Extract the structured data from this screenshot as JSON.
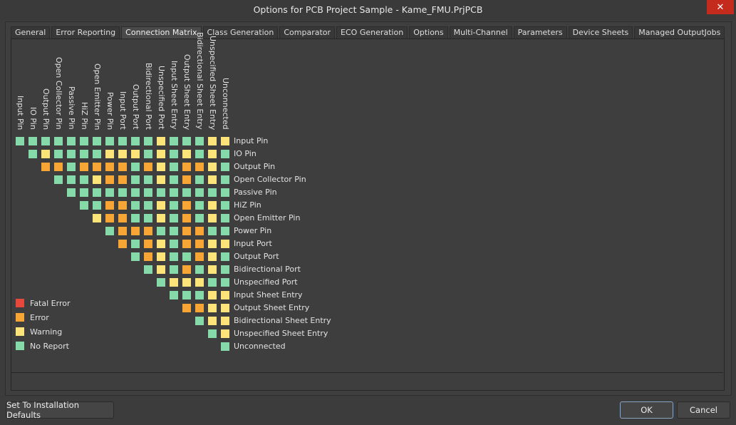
{
  "window": {
    "title": "Options for PCB Project Sample - Kame_FMU.PrjPCB",
    "close_label": "✕"
  },
  "tabs": [
    {
      "label": "General",
      "active": false
    },
    {
      "label": "Error Reporting",
      "active": false
    },
    {
      "label": "Connection Matrix",
      "active": true
    },
    {
      "label": "Class Generation",
      "active": false
    },
    {
      "label": "Comparator",
      "active": false
    },
    {
      "label": "ECO Generation",
      "active": false
    },
    {
      "label": "Options",
      "active": false
    },
    {
      "label": "Multi-Channel",
      "active": false
    },
    {
      "label": "Parameters",
      "active": false
    },
    {
      "label": "Device Sheets",
      "active": false
    },
    {
      "label": "Managed OutputJobs",
      "active": false
    }
  ],
  "matrix": {
    "labels": [
      "Input Pin",
      "IO Pin",
      "Output Pin",
      "Open Collector Pin",
      "Passive Pin",
      "HiZ Pin",
      "Open Emitter Pin",
      "Power Pin",
      "Input Port",
      "Output Port",
      "Bidirectional Port",
      "Unspecified Port",
      "Input Sheet Entry",
      "Output Sheet Entry",
      "Bidirectional Sheet Entry",
      "Unspecified Sheet Entry",
      "Unconnected"
    ],
    "rows": [
      "GGGGGGGGGGGYGGGYY",
      "GYGGGGYYYGYGYGYG",
      "OOGOOOOGOYGOOYG",
      "GGGYOOGGYGOGYG",
      "GGGGGGGGGGGGG",
      "GGOOGGYGOGYG",
      "YOOGGYGOGYG",
      "GOOOGGOOGG",
      "OGOYGOOYY",
      "GOYGGOYG",
      "GYGOGYG",
      "GYYYGG",
      "GGGYY",
      "OOYY",
      "GYY",
      "GY",
      "G"
    ]
  },
  "legend": [
    {
      "key": "F",
      "label": "Fatal Error",
      "color": "#e8483b"
    },
    {
      "key": "O",
      "label": "Error",
      "color": "#f7a535"
    },
    {
      "key": "Y",
      "label": "Warning",
      "color": "#fde47a"
    },
    {
      "key": "G",
      "label": "No Report",
      "color": "#86d9a8"
    }
  ],
  "buttons": {
    "defaults": "Set To Installation Defaults",
    "ok": "OK",
    "cancel": "Cancel"
  }
}
